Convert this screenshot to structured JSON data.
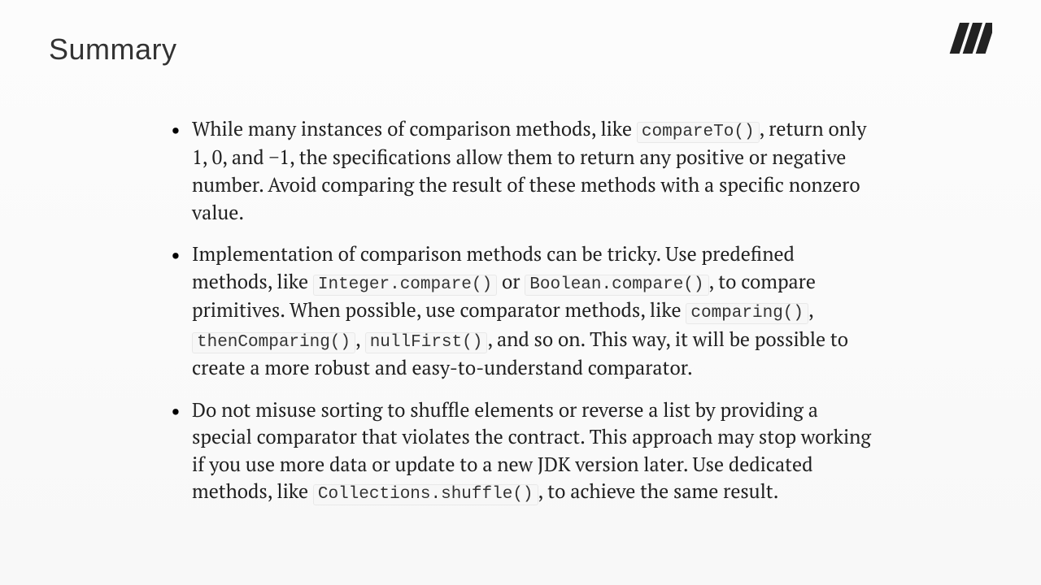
{
  "title": "Summary",
  "bullets": [
    {
      "p0": "While many instances of comparison methods, like ",
      "c0": "compareTo()",
      "p1": ", return only 1, 0, and −1, the specifications allow them to return any positive or negative number. Avoid comparing the result of these methods with a specific nonzero value."
    },
    {
      "p0": "Implementation of comparison methods can be tricky. Use predefined methods, like ",
      "c0": "Integer.compare()",
      "p1": " or ",
      "c1": "Boolean.compare()",
      "p2": ", to compare primitives. When possible, use comparator methods, like ",
      "c2": "comparing()",
      "p3": ", ",
      "c3": "thenComparing()",
      "p4": ", ",
      "c4": "nullFirst()",
      "p5": ", and so on. This way, it will be possible to create a more robust and easy-to-understand comparator."
    },
    {
      "p0": "Do not misuse sorting to shuffle elements or reverse a list by providing a special comparator that violates the contract. This approach may stop working if you use more data or update to a new JDK version later. Use dedicated methods, like ",
      "c0": "Collections.shuffle()",
      "p1": ", to achieve the same result."
    }
  ]
}
